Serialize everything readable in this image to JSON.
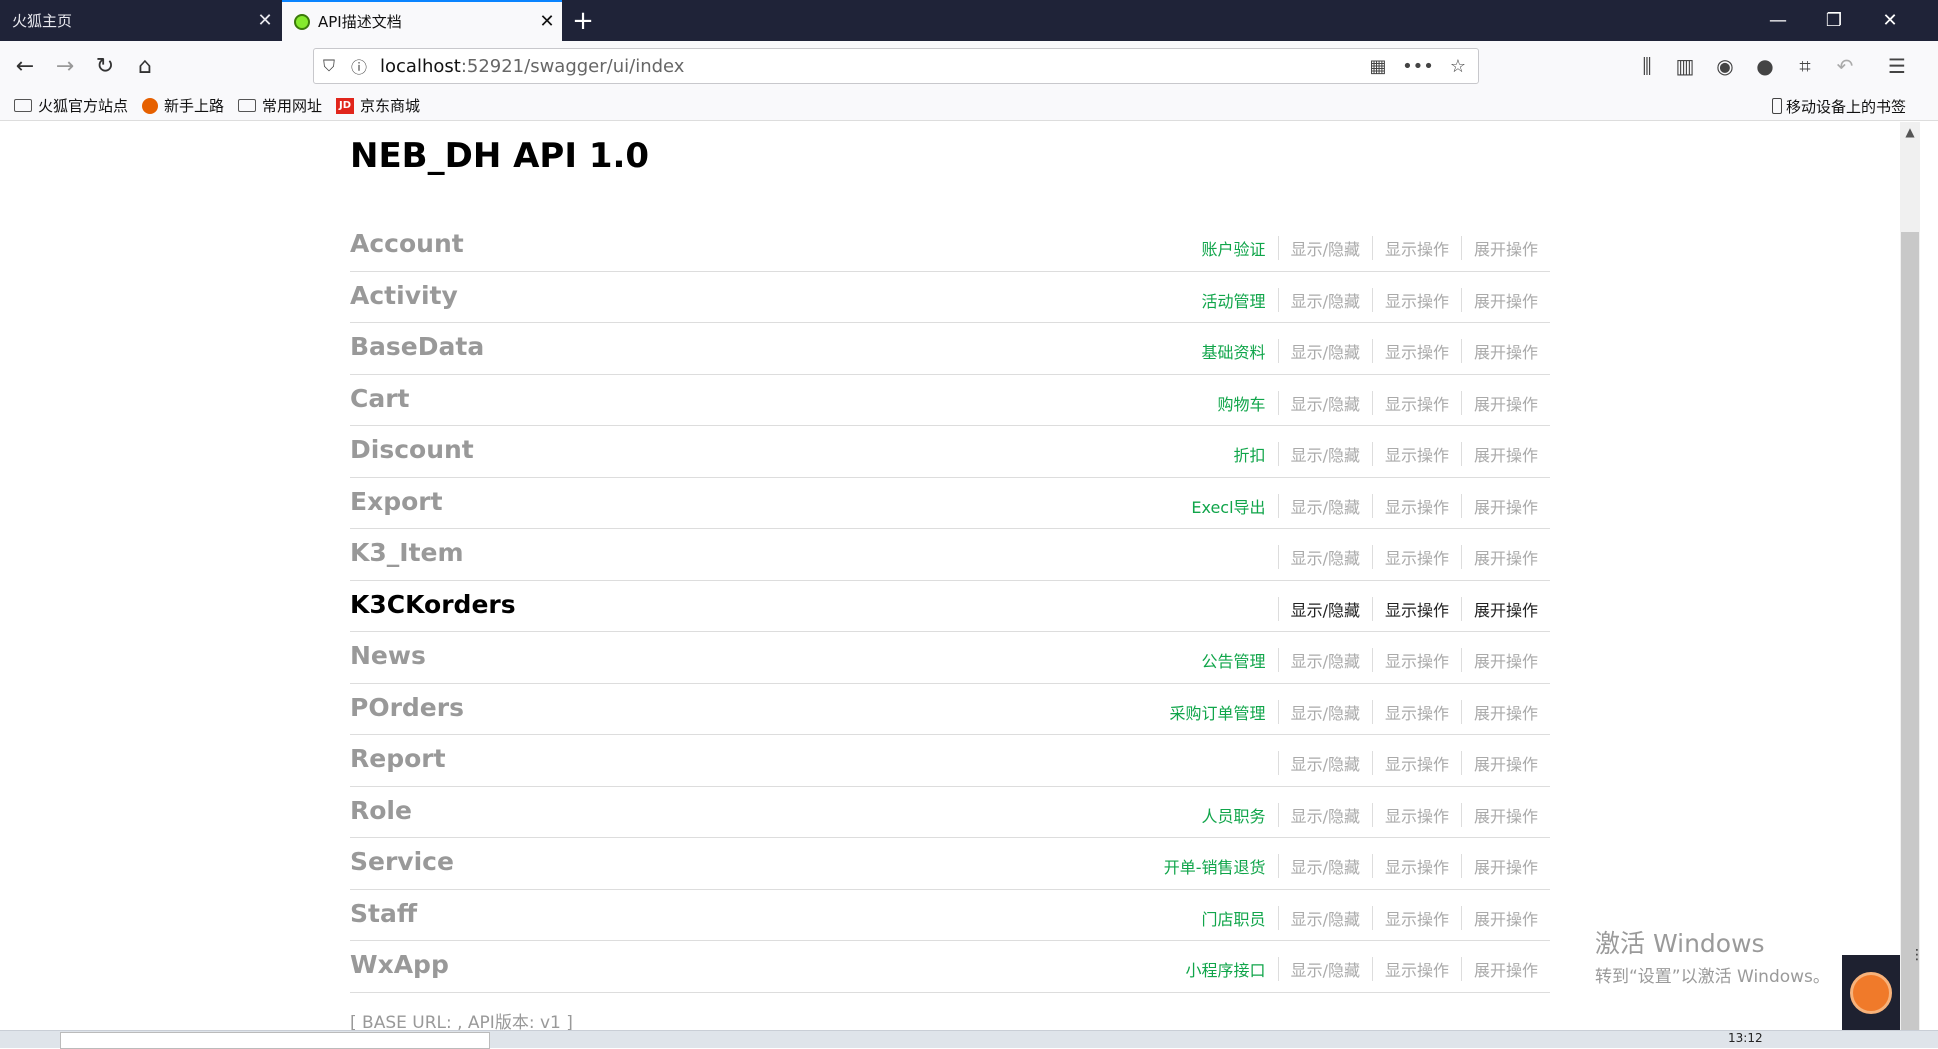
{
  "browser": {
    "tabs": [
      {
        "title": "火狐主页",
        "active": false
      },
      {
        "title": "API描述文档",
        "active": true
      }
    ],
    "url": {
      "host": "localhost",
      "rest": ":52921/swagger/ui/index"
    },
    "bookmarks": [
      {
        "label": "火狐官方站点",
        "icon": "folder-icon"
      },
      {
        "label": "新手上路",
        "icon": "firefox-icon"
      },
      {
        "label": "常用网址",
        "icon": "folder-icon"
      },
      {
        "label": "京东商城",
        "icon": "jd-icon"
      }
    ],
    "mobile_bookmarks": "移动设备上的书签",
    "jd_badge": "JD"
  },
  "page": {
    "title": "NEB_DH API 1.0",
    "ops": {
      "toggle": "显示/隐藏",
      "list": "显示操作",
      "expand": "展开操作"
    },
    "resources": [
      {
        "name": "Account",
        "desc": "账户验证",
        "active": false
      },
      {
        "name": "Activity",
        "desc": "活动管理",
        "active": false
      },
      {
        "name": "BaseData",
        "desc": "基础资料",
        "active": false
      },
      {
        "name": "Cart",
        "desc": "购物车",
        "active": false
      },
      {
        "name": "Discount",
        "desc": "折扣",
        "active": false
      },
      {
        "name": "Export",
        "desc": "Execl导出",
        "active": false
      },
      {
        "name": "K3_Item",
        "desc": "",
        "active": false
      },
      {
        "name": "K3CKorders",
        "desc": "",
        "active": true
      },
      {
        "name": "News",
        "desc": "公告管理",
        "active": false
      },
      {
        "name": "POrders",
        "desc": "采购订单管理",
        "active": false
      },
      {
        "name": "Report",
        "desc": "",
        "active": false
      },
      {
        "name": "Role",
        "desc": "人员职务",
        "active": false
      },
      {
        "name": "Service",
        "desc": "开单-销售退货",
        "active": false
      },
      {
        "name": "Staff",
        "desc": "门店职员",
        "active": false
      },
      {
        "name": "WxApp",
        "desc": "小程序接口",
        "active": false
      }
    ],
    "footer": "[ BASE URL: , API版本: v1 ]"
  },
  "watermark": {
    "line1": "激活 Windows",
    "line2": "转到“设置”以激活 Windows。"
  },
  "taskbar": {
    "time": "13:12"
  },
  "colors": {
    "tabstrip": "#1f2338",
    "desc_green": "#10a54a",
    "muted": "#999999"
  }
}
